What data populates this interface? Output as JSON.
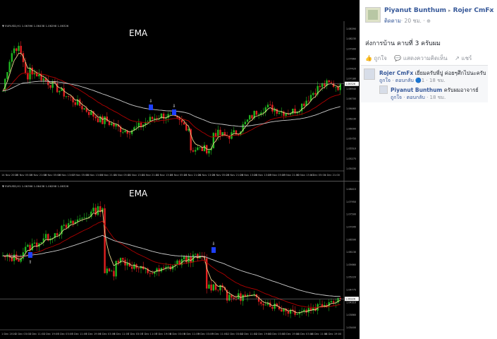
{
  "charts": [
    {
      "id": "top",
      "label": "EMA",
      "header": "▼ EURUSD,H1  1.06396  1.06438  1.06298  1.06326",
      "x_ticks": [
        "14 Nov 2016",
        "15 Nov 05:00",
        "15 Nov 21:00",
        "16 Nov 05:00",
        "16 Nov 13:00",
        "17 Nov 05:00",
        "18 Nov 13:00",
        "18 Nov 21:00",
        "21 Nov 05:00",
        "21 Nov 13:00",
        "21 Nov 21:00",
        "22 Nov 13:00",
        "23 Nov 05:00",
        "23 Nov 21:00",
        "24 Nov 13:00",
        "25 Nov 05:00",
        "25 Nov 21:00",
        "26 Nov 13:00",
        "28 Nov 13:00",
        "29 Nov 05:00",
        "29 Nov 21:00",
        "30 Nov 13:00",
        "1 Dec 05:00",
        "1 Dec 21:00"
      ],
      "y_ticks": [
        "1.08390",
        "1.08235",
        "1.07900",
        "1.07660",
        "1.07420",
        "1.07180",
        "1.06940",
        "1.06700",
        "1.06460",
        "1.06230",
        "1.06000",
        "1.05755",
        "1.05510",
        "1.05275",
        "1.05030"
      ],
      "price_tag": "1.06326"
    },
    {
      "id": "bottom",
      "label": "EMA",
      "header": "▼ EURUSD,H1  1.06396  1.06438  1.06298  1.06326",
      "x_ticks": [
        "1 Dec 2016",
        "2 Dec 03:00",
        "2 Dec 11:00",
        "2 Dec 19:00",
        "5 Dec 03:00",
        "5 Dec 11:00",
        "5 Dec 19:00",
        "6 Dec 03:00",
        "6 Dec 11:00",
        "7 Dec 03:00",
        "7 Dec 11:00",
        "7 Dec 19:00",
        "8 Dec 03:00",
        "8 Dec 11:00",
        "9 Dec 03:00",
        "9 Dec 11:00",
        "12 Dec 03:00",
        "12 Dec 11:00",
        "12 Dec 19:00",
        "13 Dec 03:00",
        "13 Dec 19:00",
        "14 Dec 03:00",
        "14 Dec 11:00",
        "14 Dec 19:00"
      ],
      "y_ticks": [
        "1.08415",
        "1.07950",
        "1.07500",
        "1.07045",
        "1.06590",
        "1.06130",
        "1.05660",
        "1.05220",
        "1.04775",
        "1.04310",
        "1.03860",
        "1.03400"
      ],
      "price_tag": "1.06326"
    }
  ],
  "post": {
    "author": "Piyanut Bunthum",
    "separator": "▸",
    "target": "Rojer CmFx",
    "follow": "ติดตาม",
    "time": "· 20 ชม. · ",
    "globe": "⊕",
    "text": "ส่งการบ้าน คาบที่ 3 ครับผม",
    "actions": {
      "like": "👍 ถูกใจ",
      "comment": "💬 แสดงความคิดเห็น",
      "share": "↗ แชร์"
    }
  },
  "comments": [
    {
      "name": "Rojer CmFx",
      "text": " เยี่ยมครับพี่ปู ค่อยๆศึกไปนะครับ",
      "like": "ถูกใจ",
      "reply": "ตอบกลับ",
      "reactions": "🔵1",
      "time": "· 18 ชม."
    },
    {
      "name": "Piyanut Bunthum",
      "text": " ครับผมอาจารย์",
      "like": "ถูกใจ",
      "reply": "ตอบกลับ",
      "time": "· 18 ชม."
    }
  ]
}
